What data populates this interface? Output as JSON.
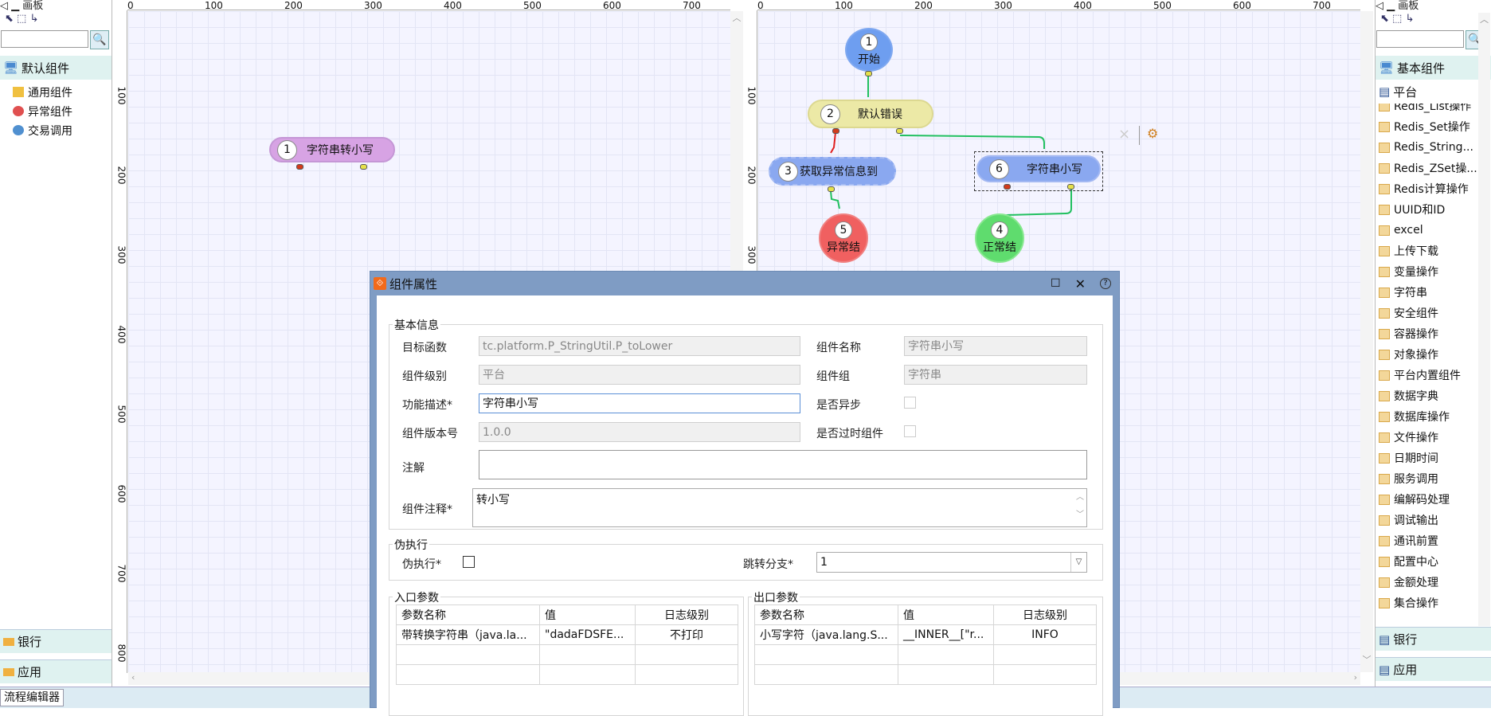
{
  "palette_left": {
    "title": "画板",
    "search_placeholder": "",
    "category": "默认组件",
    "items": [
      "通用组件",
      "异常组件",
      "交易调用"
    ],
    "bottom_cats": [
      "银行",
      "应用"
    ]
  },
  "palette_right": {
    "title": "画板",
    "search_placeholder": "",
    "category": "基本组件",
    "subcategory": "平台",
    "items": [
      "Redis_List操作",
      "Redis_Set操作",
      "Redis_String...",
      "Redis_ZSet操...",
      "Redis计算操作",
      "UUID和ID",
      "excel",
      "上传下载",
      "变量操作",
      "字符串",
      "安全组件",
      "容器操作",
      "对象操作",
      "平台内置组件",
      "数据字典",
      "数据库操作",
      "文件操作",
      "日期时间",
      "服务调用",
      "编解码处理",
      "调试输出",
      "通讯前置",
      "配置中心",
      "金额处理",
      "集合操作"
    ],
    "bottom_cats": [
      "银行",
      "应用"
    ]
  },
  "status_bar": {
    "tab": "流程编辑器"
  },
  "ruler": {
    "h": [
      "0",
      "100",
      "200",
      "300",
      "400",
      "500",
      "600",
      "700"
    ],
    "v": [
      "100",
      "200",
      "300",
      "400",
      "500",
      "600",
      "700",
      "800"
    ],
    "v2": [
      "100",
      "200",
      "300"
    ]
  },
  "canvas_left": {
    "node": {
      "num": "1",
      "label": "字符串转小写"
    }
  },
  "canvas_right": {
    "nodes": {
      "n1": {
        "num": "1",
        "label": "开始"
      },
      "n2": {
        "num": "2",
        "label": "默认错误"
      },
      "n3": {
        "num": "3",
        "label": "获取异常信息到"
      },
      "n5": {
        "num": "5",
        "label": "异常结"
      },
      "n6": {
        "num": "6",
        "label": "字符串小写"
      },
      "n4": {
        "num": "4",
        "label": "正常结"
      }
    },
    "close": "×"
  },
  "dialog": {
    "title": "组件属性",
    "basic": {
      "title": "基本信息",
      "target_func_label": "目标函数",
      "target_func": "tc.platform.P_StringUtil.P_toLower",
      "name_label": "组件名称",
      "name": "字符串小写",
      "level_label": "组件级别",
      "level": "平台",
      "group_label": "组件组",
      "group": "字符串",
      "desc_label": "功能描述*",
      "desc": "字符串小写",
      "async_label": "是否异步",
      "version_label": "组件版本号",
      "version": "1.0.0",
      "deprecated_label": "是否过时组件",
      "note_label": "注解",
      "note": "",
      "comment_label": "组件注释*",
      "comment": "转小写"
    },
    "pseudo": {
      "title": "伪执行",
      "exec_label": "伪执行*",
      "jump_label": "跳转分支*",
      "jump_value": "1"
    },
    "input": {
      "title": "入口参数",
      "headers": [
        "参数名称",
        "值",
        "日志级别"
      ],
      "rows": [
        [
          "带转换字符串（java.la...",
          "\"dadaFDSFE...",
          "不打印"
        ]
      ]
    },
    "output": {
      "title": "出口参数",
      "headers": [
        "参数名称",
        "值",
        "日志级别"
      ],
      "rows": [
        [
          "小写字符（java.lang.S...",
          "__INNER__[\"r...",
          "INFO"
        ]
      ]
    }
  }
}
